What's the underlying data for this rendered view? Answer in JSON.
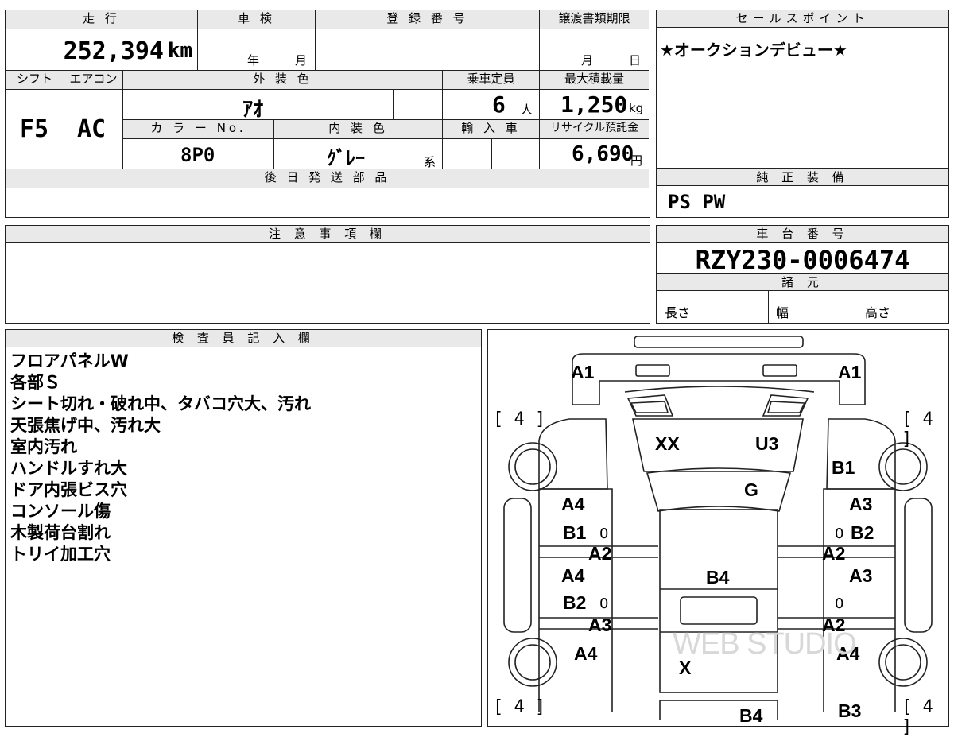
{
  "top_summary": {
    "labels": {
      "mileage": "走 行",
      "inspection": "車 検",
      "registration": "登 録 番 号",
      "transfer_deadline": "譲渡書類期限",
      "shift": "シフト",
      "aircon": "エアコン",
      "exterior_color": "外 装 色",
      "capacity": "乗車定員",
      "max_load": "最大積載量",
      "color_no": "カ ラ ー No.",
      "interior_color": "内 装 色",
      "import": "輸 入 車",
      "recycle_fee": "リサイクル預託金"
    },
    "mileage_value": "252,394",
    "mileage_unit": "km",
    "inspection_year_unit": "年",
    "inspection_month_unit": "月",
    "deadline_month_unit": "月",
    "deadline_day_unit": "日",
    "shift_value": "F5",
    "aircon_value": "AC",
    "exterior_color_value": "ｱｵ",
    "capacity_value": "6",
    "capacity_unit": "人",
    "max_load_value": "1,250",
    "max_load_unit": "kg",
    "color_no_value": "8P0",
    "interior_color_value": "ｸﾞﾚｰ",
    "interior_color_suffix": "系",
    "recycle_fee_value": "6,690",
    "recycle_fee_unit": "円",
    "later_parts_label": "後 日 発 送 部 品"
  },
  "sales_point": {
    "label": "セールスポイント",
    "text": "★オークションデビュー★"
  },
  "genuine_equipment": {
    "label": "純 正 装 備",
    "text": "PS PW"
  },
  "notes": {
    "label": "注 意 事 項 欄"
  },
  "chassis": {
    "label": "車 台 番 号",
    "number": "RZY230-0006474",
    "specs_label": "諸 元",
    "length_label": "長さ",
    "width_label": "幅",
    "height_label": "高さ"
  },
  "inspector": {
    "label": "検 査 員 記 入 欄",
    "lines": [
      "フロアパネルW",
      "各部Ｓ",
      "シート切れ・破れ中、タバコ穴大、汚れ",
      "天張焦げ中、汚れ大",
      "室内汚れ",
      "ハンドルすれ大",
      "ドア内張ビス穴",
      "コンソール傷",
      "木製荷台割れ",
      "トリイ加工穴"
    ]
  },
  "diagram": {
    "tire_marks": [
      "[ 4 ]",
      "[ 4 ]",
      "[ 4 ]",
      "[ 4 ]"
    ],
    "marks": {
      "front_left": "A1",
      "front_right": "A1",
      "windshield_left": "XX",
      "windshield_right": "U3",
      "right_fender": "B1",
      "hood": "G",
      "left_front_door_a": "A4",
      "left_front_door_b": "B1",
      "right_front_door_a": "A3",
      "right_front_door_b": "B2",
      "left_step_1": "A2",
      "right_step_1": "A2",
      "left_rear_door_a": "A4",
      "left_rear_door_b": "B2",
      "center": "B4",
      "right_rear_door": "A3",
      "left_step_2": "A3",
      "right_step_2": "A2",
      "left_rear": "A4",
      "center_rear": "X",
      "right_rear": "A4",
      "bottom_center": "B4",
      "bottom_right": "B3"
    },
    "zero_marks": [
      "0",
      "0",
      "0",
      "0"
    ],
    "watermark": "WEB STUDIO"
  }
}
